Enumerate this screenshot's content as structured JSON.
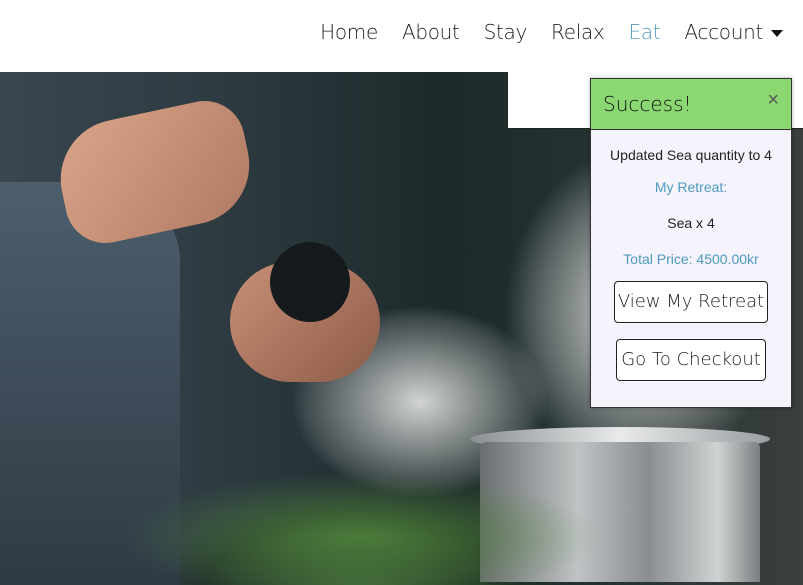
{
  "nav": {
    "items": [
      {
        "label": "Home",
        "active": false
      },
      {
        "label": "About",
        "active": false
      },
      {
        "label": "Stay",
        "active": false
      },
      {
        "label": "Relax",
        "active": false
      },
      {
        "label": "Eat",
        "active": true
      },
      {
        "label": "Account",
        "active": false
      }
    ],
    "active_color": "#5b9bb8"
  },
  "toast": {
    "title": "Success!",
    "close_icon": "close-icon",
    "message": "Updated Sea quantity to 4",
    "retreat_label": "My Retreat:",
    "item_line": "Sea x 4",
    "total": "Total Price: 4500.00kr",
    "view_button": "View My Retreat",
    "checkout_button": "Go To Checkout",
    "header_color": "#8bd873",
    "accent_color": "#4f9ac0"
  }
}
